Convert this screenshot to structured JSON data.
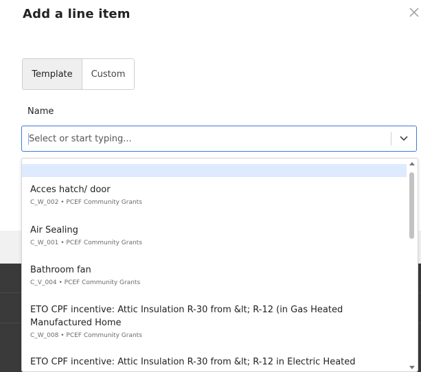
{
  "modal": {
    "title": "Add a line item",
    "close_icon": "close-icon"
  },
  "tabs": [
    {
      "label": "Template",
      "active": true
    },
    {
      "label": "Custom",
      "active": false
    }
  ],
  "name_field": {
    "label": "Name",
    "placeholder": "Select or start typing...",
    "value": ""
  },
  "options": [
    {
      "title": "Acces hatch/ door",
      "meta": "C_W_002 • PCEF Community Grants"
    },
    {
      "title": "Air Sealing",
      "meta": "C_W_001 • PCEF Community Grants"
    },
    {
      "title": "Bathroom fan",
      "meta": "C_V_004 • PCEF Community Grants"
    },
    {
      "title": "ETO CPF incentive: Attic Insulation R-30 from &lt; R-12 (in Gas Heated Manufactured Home",
      "meta": "C_W_008 • PCEF Community Grants"
    },
    {
      "title": "ETO CPF incentive: Attic Insulation R-30 from &lt; R-12 in Electric Heated"
    }
  ],
  "colors": {
    "focus_border": "#3b7bd6",
    "highlight": "#deebff",
    "active_tab": "#efefef"
  }
}
